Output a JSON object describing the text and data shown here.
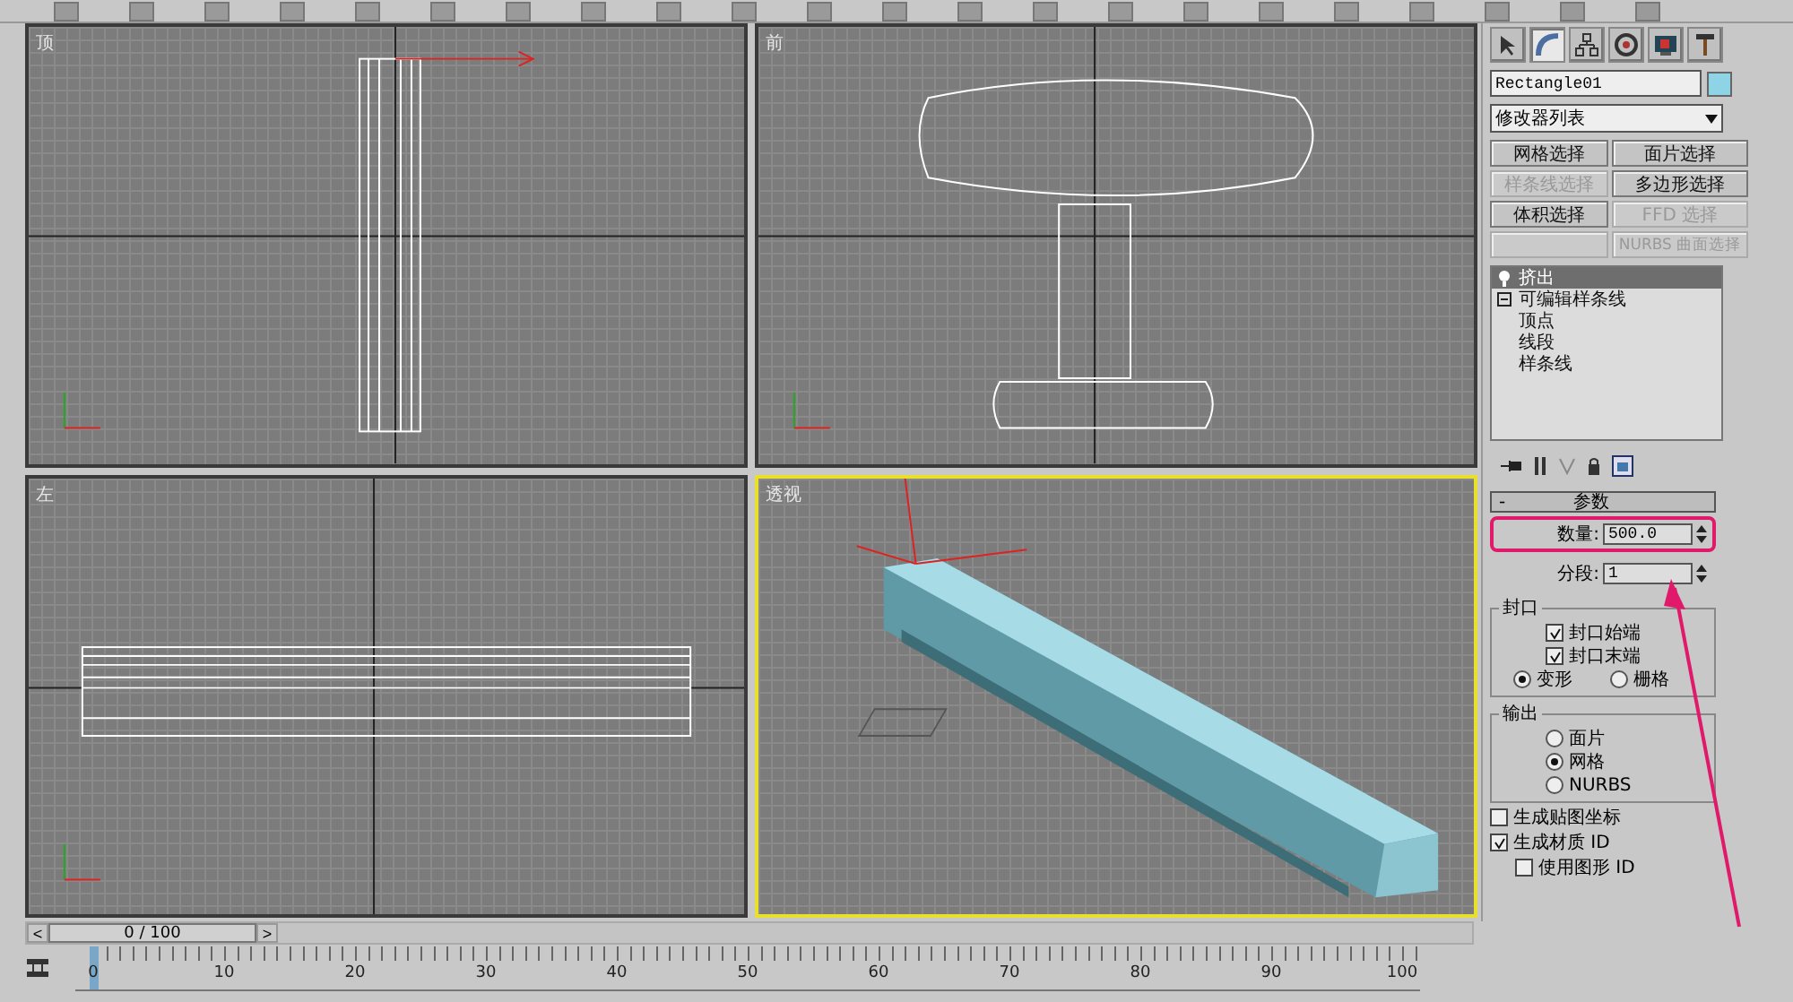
{
  "viewports": [
    {
      "label": "顶",
      "selected": false
    },
    {
      "label": "前",
      "selected": false
    },
    {
      "label": "左",
      "selected": false
    },
    {
      "label": "透视",
      "selected": true
    }
  ],
  "command_panel": {
    "tabs": [
      {
        "selected": false
      },
      {
        "selected": true
      },
      {
        "selected": false
      },
      {
        "selected": false
      },
      {
        "selected": false
      },
      {
        "selected": false
      }
    ],
    "object_name": "Rectangle01",
    "modifier_list": "修改器列表",
    "modifier_buttons": [
      {
        "label": "网格选择",
        "disabled": false
      },
      {
        "label": "面片选择",
        "disabled": false
      },
      {
        "label": "样条线选择",
        "disabled": true
      },
      {
        "label": "多边形选择",
        "disabled": false
      },
      {
        "label": "体积选择",
        "disabled": false
      },
      {
        "label": "FFD 选择",
        "disabled": true
      },
      {
        "disabled": true
      },
      {
        "label": "NURBS 曲面选择",
        "disabled": true
      }
    ],
    "stack": [
      {
        "label": "挤出",
        "selected": true
      },
      {
        "label": "可编辑样条线",
        "selected": false,
        "expanded": true,
        "children": [
          {
            "label": "顶点"
          },
          {
            "label": "线段"
          },
          {
            "label": "样条线"
          }
        ]
      }
    ],
    "rollout": {
      "toggle": "-",
      "title": "参数",
      "spinners": [
        {
          "label": "数量:",
          "value": "500.0",
          "highlighted": true
        },
        {
          "label": "分段:",
          "value": "1"
        }
      ],
      "groups": [
        {
          "title": "封口",
          "items": [
            {
              "kind": "checkbox",
              "label": "封口始端",
              "checked": true
            },
            {
              "kind": "checkbox",
              "label": "封口末端",
              "checked": true
            },
            {
              "kind": "radio-pair",
              "options": [
                {
                  "label": "变形",
                  "selected": true
                },
                {
                  "label": "栅格",
                  "selected": false
                }
              ]
            }
          ]
        },
        {
          "title": "输出",
          "items": [
            {
              "kind": "radio",
              "label": "面片",
              "selected": false
            },
            {
              "kind": "radio",
              "label": "网格",
              "selected": true
            },
            {
              "kind": "radio",
              "label": "NURBS",
              "selected": false
            }
          ]
        }
      ],
      "checkboxes": [
        {
          "kind": "main",
          "label": "生成贴图坐标",
          "checked": false
        },
        {
          "kind": "main",
          "label": "生成材质 ID",
          "checked": true
        },
        {
          "kind": "sub",
          "label": "使用图形 ID",
          "checked": false
        }
      ]
    }
  },
  "time_slider": {
    "prev": "<",
    "position": "0 / 100",
    "next": ">",
    "level": 0
  },
  "track_bar": {
    "ticks": [
      {
        "label": "0",
        "selected": true
      },
      {
        "label": "10",
        "selected": false
      },
      {
        "label": "20",
        "selected": false
      },
      {
        "label": "30",
        "selected": false
      },
      {
        "label": "40",
        "selected": false
      },
      {
        "label": "50",
        "selected": false
      },
      {
        "label": "60",
        "selected": false
      },
      {
        "label": "70",
        "selected": false
      },
      {
        "label": "80",
        "selected": false
      },
      {
        "label": "90",
        "selected": false
      },
      {
        "label": "100",
        "selected": false
      }
    ]
  }
}
